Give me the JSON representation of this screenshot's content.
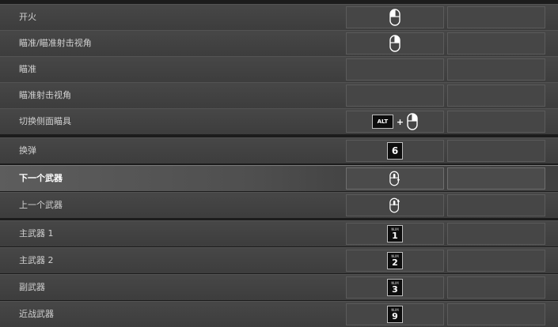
{
  "rows": [
    {
      "label": "开火",
      "binding": {
        "kind": "mouse",
        "variant": "left-click"
      }
    },
    {
      "label": "瞄准/瞄准射击视角",
      "binding": {
        "kind": "mouse",
        "variant": "right-click"
      }
    },
    {
      "label": "瞄准",
      "binding": null
    },
    {
      "label": "瞄准射击视角",
      "binding": null
    },
    {
      "label": "切换侧面瞄具",
      "binding": {
        "kind": "combo",
        "key": "ALT",
        "plus": "+",
        "variant": "right-click"
      }
    },
    {
      "label": "换弹",
      "binding": {
        "kind": "key",
        "key": "6"
      }
    },
    {
      "label": "下一个武器",
      "binding": {
        "kind": "mouse",
        "variant": "wheel-down"
      },
      "selected": true
    },
    {
      "label": "上一个武器",
      "binding": {
        "kind": "mouse",
        "variant": "wheel-up"
      }
    },
    {
      "label": "主武器 1",
      "binding": {
        "kind": "numkey",
        "top": "NUM",
        "key": "1"
      }
    },
    {
      "label": "主武器 2",
      "binding": {
        "kind": "numkey",
        "top": "NUM",
        "key": "2"
      }
    },
    {
      "label": "副武器",
      "binding": {
        "kind": "numkey",
        "top": "NUM",
        "key": "3"
      }
    },
    {
      "label": "近战武器",
      "binding": {
        "kind": "numkey",
        "top": "NUM",
        "key": "9"
      }
    }
  ],
  "colors": {
    "row_bg": "#474747",
    "slot_bg": "#464646",
    "text": "#d0d0d0",
    "selected_text": "#ffffff"
  }
}
